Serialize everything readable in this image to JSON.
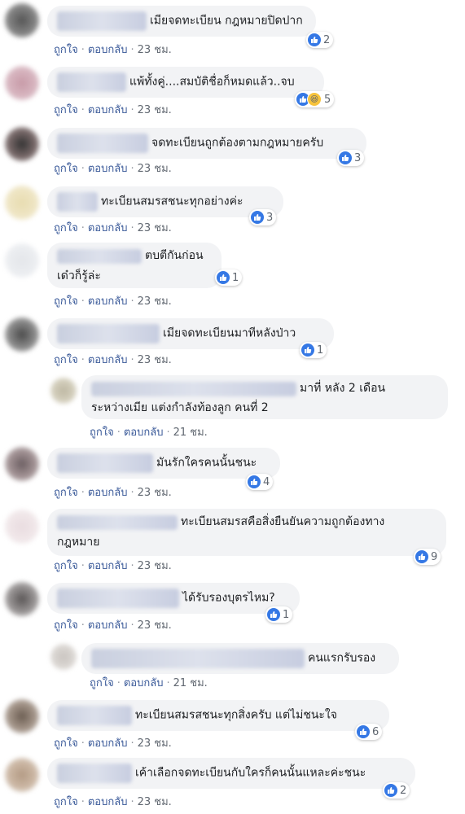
{
  "comments": [
    {
      "text": "เมียจดทะเบียน กฎหมายปิดปาก",
      "reactions": "2",
      "like": "ถูกใจ",
      "reply": "ตอบกลับ",
      "time": "23 ชม.",
      "haha": false
    },
    {
      "text": "แพ้ทั้งคู่....สมบัติชื่อก็หมดแล้ว..จบ",
      "reactions": "5",
      "like": "ถูกใจ",
      "reply": "ตอบกลับ",
      "time": "23 ชม.",
      "haha": true
    },
    {
      "text": "จดทะเบียนถูกต้องตามกฎหมายครับ",
      "reactions": "3",
      "like": "ถูกใจ",
      "reply": "ตอบกลับ",
      "time": "23 ชม.",
      "haha": false
    },
    {
      "text": "ทะเบียนสมรสชนะทุกอย่างค่ะ",
      "reactions": "3",
      "like": "ถูกใจ",
      "reply": "ตอบกลับ",
      "time": "23 ชม.",
      "haha": false
    },
    {
      "text": "ตบตีกันก่อน",
      "text2": "เด๋วก็รู้ล่ะ",
      "reactions": "1",
      "like": "ถูกใจ",
      "reply": "ตอบกลับ",
      "time": "23 ชม.",
      "haha": false
    },
    {
      "text": "เมียจดทะเบียนมาทีหลังป่าว",
      "reactions": "1",
      "like": "ถูกใจ",
      "reply": "ตอบกลับ",
      "time": "23 ชม.",
      "haha": false
    },
    {
      "text": "มาที่ หลัง 2 เดือน",
      "text2": "ระหว่างเมีย แต่งกำลังท้องลูก คนที่ 2",
      "reactions": "",
      "like": "ถูกใจ",
      "reply": "ตอบกลับ",
      "time": "21 ชม.",
      "haha": false
    },
    {
      "text": "มันรักใครคนนั้นชนะ",
      "reactions": "4",
      "like": "ถูกใจ",
      "reply": "ตอบกลับ",
      "time": "23 ชม.",
      "haha": false
    },
    {
      "text": "ทะเบียนสมรสคือสิ่งยืนยันความถูกต้องทาง",
      "text2": "กฎหมาย",
      "reactions": "9",
      "like": "ถูกใจ",
      "reply": "ตอบกลับ",
      "time": "23 ชม.",
      "haha": false
    },
    {
      "text": "ได้รับรองบุตรไหม?",
      "reactions": "1",
      "like": "ถูกใจ",
      "reply": "ตอบกลับ",
      "time": "23 ชม.",
      "haha": false
    },
    {
      "text": "คนแรกรับรอง",
      "reactions": "",
      "like": "ถูกใจ",
      "reply": "ตอบกลับ",
      "time": "21 ชม.",
      "haha": false
    },
    {
      "text": "ทะเบียนสมรสชนะทุกสิ่งครับ แต่ไม่ชนะใจ",
      "reactions": "6",
      "like": "ถูกใจ",
      "reply": "ตอบกลับ",
      "time": "23 ชม.",
      "haha": false
    },
    {
      "text": "เค้าเลือกจดทะเบียนกับใครก็คนนั้นแหละค่ะชนะ",
      "reactions": "2",
      "like": "ถูกใจ",
      "reply": "ตอบกลับ",
      "time": "23 ชม.",
      "haha": false
    }
  ],
  "colors": {
    "accent": "#3578e5",
    "bubble": "#f2f3f5",
    "meta": "#606770"
  }
}
